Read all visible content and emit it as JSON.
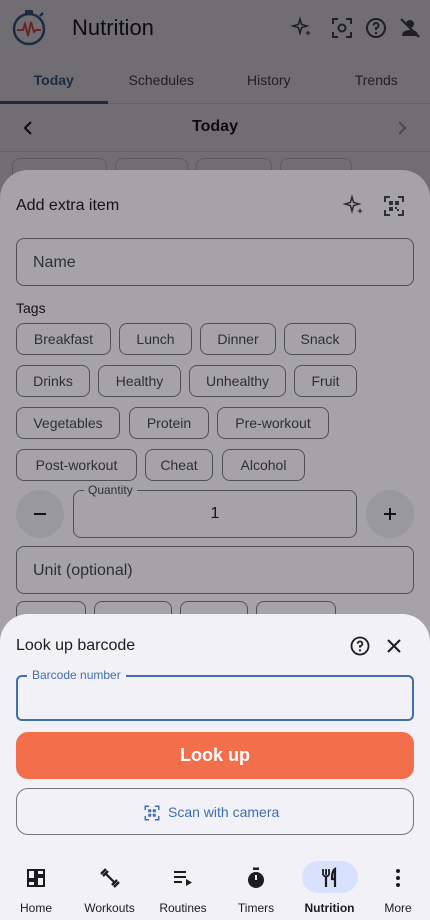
{
  "app": {
    "title": "Nutrition"
  },
  "tabs": [
    {
      "label": "Today",
      "active": true
    },
    {
      "label": "Schedules",
      "active": false
    },
    {
      "label": "History",
      "active": false
    },
    {
      "label": "Trends",
      "active": false
    }
  ],
  "date_bar": {
    "label": "Today"
  },
  "add_item_sheet": {
    "title": "Add extra item",
    "name_placeholder": "Name",
    "tags_label": "Tags",
    "tags": [
      "Breakfast",
      "Lunch",
      "Dinner",
      "Snack",
      "Drinks",
      "Healthy",
      "Unhealthy",
      "Fruit",
      "Vegetables",
      "Protein",
      "Pre-workout",
      "Post-workout",
      "Cheat",
      "Alcohol"
    ],
    "quantity_label": "Quantity",
    "quantity_value": "1",
    "unit_placeholder": "Unit (optional)"
  },
  "barcode_sheet": {
    "title": "Look up barcode",
    "barcode_label": "Barcode number",
    "barcode_value": "",
    "lookup_button": "Look up",
    "scan_button": "Scan with camera"
  },
  "bottom_nav": [
    {
      "label": "Home",
      "icon": "dashboard-icon",
      "active": false
    },
    {
      "label": "Workouts",
      "icon": "dumbbell-icon",
      "active": false
    },
    {
      "label": "Routines",
      "icon": "playlist-play-icon",
      "active": false
    },
    {
      "label": "Timers",
      "icon": "stopwatch-icon",
      "active": false
    },
    {
      "label": "Nutrition",
      "icon": "fork-knife-icon",
      "active": true
    },
    {
      "label": "More",
      "icon": "more-vert-icon",
      "active": false
    }
  ],
  "colors": {
    "primary": "#3f6fb0",
    "lookup_button": "#f36f4c",
    "nav_active_pill": "#d8e2ff",
    "surface": "#f3f1f8"
  }
}
